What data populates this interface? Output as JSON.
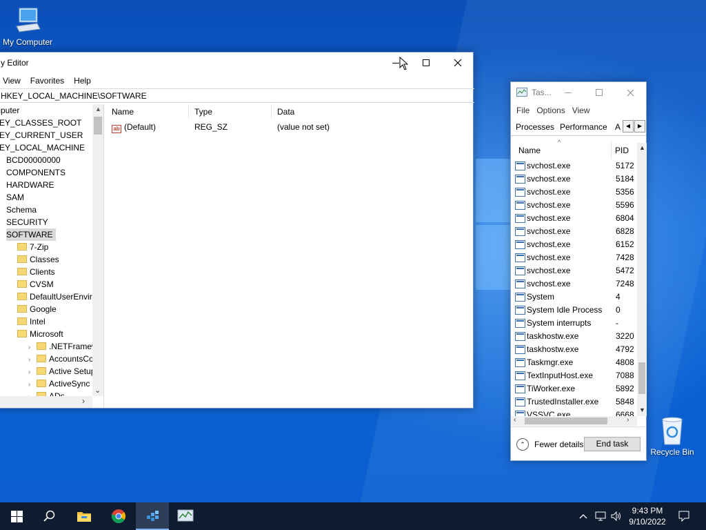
{
  "desktop": {
    "icons": [
      {
        "label": "My Computer"
      },
      {
        "label": "Recycle Bin"
      }
    ]
  },
  "regedit": {
    "title": "y Editor",
    "menu": [
      "View",
      "Favorites",
      "Help"
    ],
    "address": "HKEY_LOCAL_MACHINE\\SOFTWARE",
    "tree": [
      {
        "label": "mputer",
        "indent": 0,
        "folder": false,
        "expander": ""
      },
      {
        "label": "KEY_CLASSES_ROOT",
        "indent": 0,
        "folder": false,
        "expander": ""
      },
      {
        "label": "KEY_CURRENT_USER",
        "indent": 0,
        "folder": false,
        "expander": ""
      },
      {
        "label": "KEY_LOCAL_MACHINE",
        "indent": 0,
        "folder": false,
        "expander": ""
      },
      {
        "label": "BCD00000000",
        "indent": 1,
        "folder": false,
        "expander": ""
      },
      {
        "label": "COMPONENTS",
        "indent": 1,
        "folder": false,
        "expander": ""
      },
      {
        "label": "HARDWARE",
        "indent": 1,
        "folder": false,
        "expander": ""
      },
      {
        "label": "SAM",
        "indent": 1,
        "folder": false,
        "expander": ""
      },
      {
        "label": "Schema",
        "indent": 1,
        "folder": false,
        "expander": ""
      },
      {
        "label": "SECURITY",
        "indent": 1,
        "folder": false,
        "expander": ""
      },
      {
        "label": "SOFTWARE",
        "indent": 1,
        "folder": false,
        "expander": "",
        "selected": true
      },
      {
        "label": "7-Zip",
        "indent": 2,
        "folder": true,
        "expander": ""
      },
      {
        "label": "Classes",
        "indent": 2,
        "folder": true,
        "expander": ""
      },
      {
        "label": "Clients",
        "indent": 2,
        "folder": true,
        "expander": ""
      },
      {
        "label": "CVSM",
        "indent": 2,
        "folder": true,
        "expander": ""
      },
      {
        "label": "DefaultUserEnvironn",
        "indent": 2,
        "folder": true,
        "expander": ""
      },
      {
        "label": "Google",
        "indent": 2,
        "folder": true,
        "expander": ""
      },
      {
        "label": "Intel",
        "indent": 2,
        "folder": true,
        "expander": ""
      },
      {
        "label": "Microsoft",
        "indent": 2,
        "folder": true,
        "expander": ""
      },
      {
        "label": ".NETFramework",
        "indent": 3,
        "folder": true,
        "expander": "›"
      },
      {
        "label": "AccountsControl",
        "indent": 3,
        "folder": true,
        "expander": "›"
      },
      {
        "label": "Active Setup",
        "indent": 3,
        "folder": true,
        "expander": "›"
      },
      {
        "label": "ActiveSync",
        "indent": 3,
        "folder": true,
        "expander": "›"
      },
      {
        "label": "ADs",
        "indent": 3,
        "folder": true,
        "expander": "›"
      }
    ],
    "columns": [
      "Name",
      "Type",
      "Data"
    ],
    "values": [
      {
        "name": "(Default)",
        "type": "REG_SZ",
        "data": "(value not set)"
      }
    ]
  },
  "taskmgr": {
    "title": "Tas...",
    "menu": [
      "File",
      "Options",
      "View"
    ],
    "tabs": [
      "Processes",
      "Performance",
      "A"
    ],
    "columns": [
      "Name",
      "PID"
    ],
    "processes": [
      {
        "name": "svchost.exe",
        "pid": "5172"
      },
      {
        "name": "svchost.exe",
        "pid": "5184"
      },
      {
        "name": "svchost.exe",
        "pid": "5356"
      },
      {
        "name": "svchost.exe",
        "pid": "5596"
      },
      {
        "name": "svchost.exe",
        "pid": "6804"
      },
      {
        "name": "svchost.exe",
        "pid": "6828"
      },
      {
        "name": "svchost.exe",
        "pid": "6152"
      },
      {
        "name": "svchost.exe",
        "pid": "7428"
      },
      {
        "name": "svchost.exe",
        "pid": "5472"
      },
      {
        "name": "svchost.exe",
        "pid": "7248"
      },
      {
        "name": "System",
        "pid": "4"
      },
      {
        "name": "System Idle Process",
        "pid": "0"
      },
      {
        "name": "System interrupts",
        "pid": "-"
      },
      {
        "name": "taskhostw.exe",
        "pid": "3220"
      },
      {
        "name": "taskhostw.exe",
        "pid": "4792"
      },
      {
        "name": "Taskmgr.exe",
        "pid": "4808"
      },
      {
        "name": "TextInputHost.exe",
        "pid": "7088"
      },
      {
        "name": "TiWorker.exe",
        "pid": "5892"
      },
      {
        "name": "TrustedInstaller.exe",
        "pid": "5848"
      },
      {
        "name": "VSSVC.exe",
        "pid": "6668"
      }
    ],
    "fewer_details": "Fewer details",
    "end_task": "End task"
  },
  "taskbar": {
    "time": "9:43 PM",
    "date": "9/10/2022"
  }
}
